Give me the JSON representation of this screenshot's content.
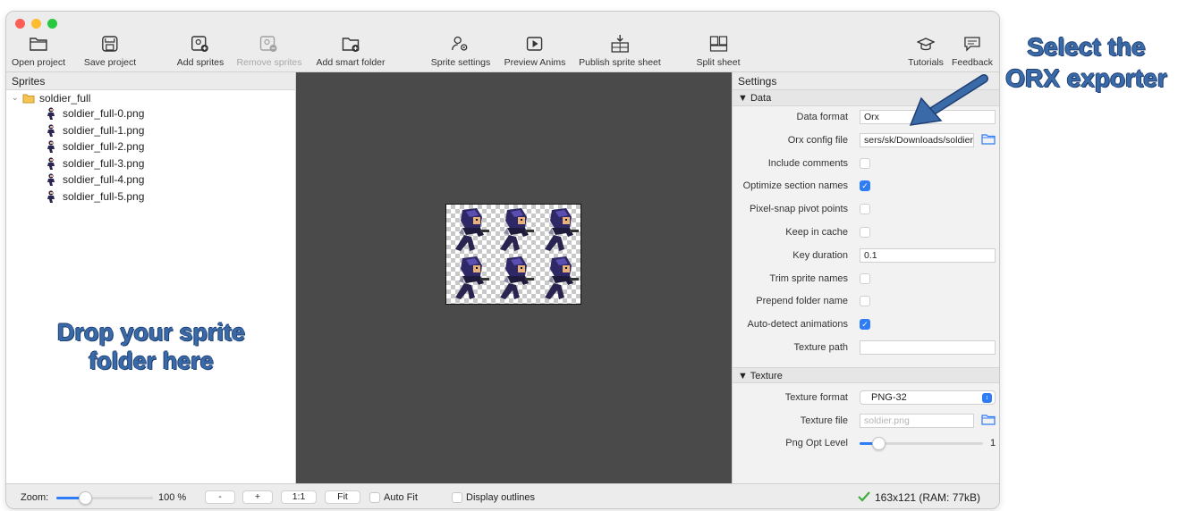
{
  "toolbar": {
    "open_project": "Open project",
    "save_project": "Save project",
    "add_sprites": "Add sprites",
    "remove_sprites": "Remove sprites",
    "add_smart_folder": "Add smart folder",
    "sprite_settings": "Sprite settings",
    "preview_anims": "Preview Anims",
    "publish_sprite_sheet": "Publish sprite sheet",
    "split_sheet": "Split sheet",
    "tutorials": "Tutorials",
    "feedback": "Feedback"
  },
  "sprites_panel": {
    "title": "Sprites",
    "root_folder": "soldier_full",
    "items": [
      "soldier_full-0.png",
      "soldier_full-1.png",
      "soldier_full-2.png",
      "soldier_full-3.png",
      "soldier_full-4.png",
      "soldier_full-5.png"
    ],
    "drop_hint_line1": "Drop your sprite",
    "drop_hint_line2": "folder here"
  },
  "settings": {
    "title": "Settings",
    "data_section": "Data",
    "data_format_label": "Data format",
    "data_format_value": "Orx",
    "orx_config_label": "Orx config file",
    "orx_config_value": "sers/sk/Downloads/soldier.",
    "include_comments_label": "Include comments",
    "include_comments": false,
    "optimize_section_names_label": "Optimize section names",
    "optimize_section_names": true,
    "pixel_snap_label": "Pixel-snap pivot points",
    "pixel_snap": false,
    "keep_in_cache_label": "Keep in cache",
    "keep_in_cache": false,
    "key_duration_label": "Key duration",
    "key_duration_value": "0.1",
    "trim_sprite_names_label": "Trim sprite names",
    "trim_sprite_names": false,
    "prepend_folder_label": "Prepend folder name",
    "prepend_folder": false,
    "auto_detect_label": "Auto-detect animations",
    "auto_detect": true,
    "texture_path_label": "Texture path",
    "texture_path_value": "",
    "texture_section": "Texture",
    "texture_format_label": "Texture format",
    "texture_format_value": "PNG-32",
    "texture_file_label": "Texture file",
    "texture_file_placeholder": "soldier.png",
    "png_opt_label": "Png Opt Level",
    "png_opt_value": "1",
    "png_opt_fraction": 0.15
  },
  "statusbar": {
    "zoom_label": "Zoom:",
    "zoom_value": "100 %",
    "zoom_fraction": 0.3,
    "minus": "-",
    "plus": "+",
    "one_to_one": "1:1",
    "fit": "Fit",
    "auto_fit": "Auto Fit",
    "display_outlines": "Display outlines",
    "status_text": "163x121 (RAM: 77kB)"
  },
  "annotation": {
    "line1": "Select the",
    "line2": "ORX exporter"
  },
  "colors": {
    "accent": "#2e7cf6",
    "annotation": "#3a6aa8",
    "canvas": "#4a4a4a",
    "check_green": "#3fae3f"
  }
}
